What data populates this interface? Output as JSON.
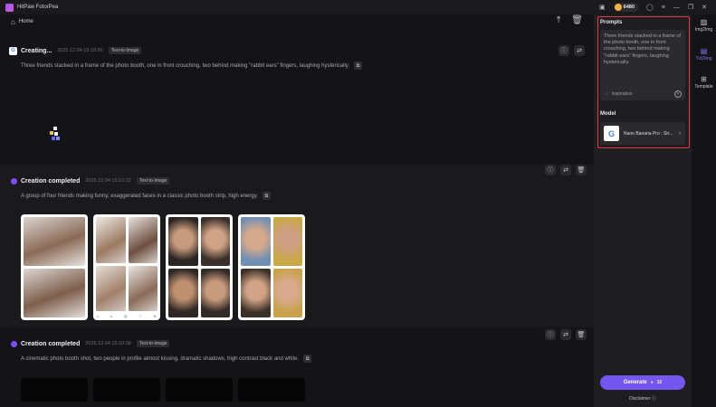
{
  "app": {
    "title": "HitPaw FotorPea"
  },
  "titlebar": {
    "credits": "6480"
  },
  "header": {
    "home_label": "Home"
  },
  "cards": [
    {
      "title": "Creating...",
      "time": "2025.12.04   15:18:50",
      "tag": "Text-to-Image",
      "prompt": "Three friends stacked in a frame of the photo booth, one in front crouching, two behind making \"rabbit ears\" fingers, laughing hysterically."
    },
    {
      "title": "Creation completed",
      "time": "2025.12.04   15:10:22",
      "tag": "Text-to-Image",
      "prompt": "A group of four friends making funny, exaggerated faces in a classic photo booth strip, high energy."
    },
    {
      "title": "Creation completed",
      "time": "2025.12.04   15:10:08",
      "tag": "Text-to-Image",
      "prompt": "A cinematic photo booth shot, two people in profile almost kissing, dramatic shadows, high contrast black and white."
    }
  ],
  "panel": {
    "prompts_label": "Prompts",
    "prompt_text": "Three friends stacked in a frame of the photo booth, one in front crouching, two behind making \"rabbit ears\" fingers, laughing hysterically.",
    "inspiration": "Inspiration",
    "model_label": "Model",
    "model_name": "Nano Banana Pro : Str...",
    "generate_label": "Generate",
    "generate_cost": "32",
    "disclaimer": "Disclaimer"
  },
  "rnav": [
    {
      "label": "Img2Img",
      "icon": "image-icon"
    },
    {
      "label": "Txt2Img",
      "icon": "text-image-icon"
    },
    {
      "label": "Template",
      "icon": "template-grid-icon"
    }
  ],
  "colors": {
    "accent": "#7456f0",
    "highlight": "#e5393f",
    "active_nav": "#8a73ff"
  }
}
